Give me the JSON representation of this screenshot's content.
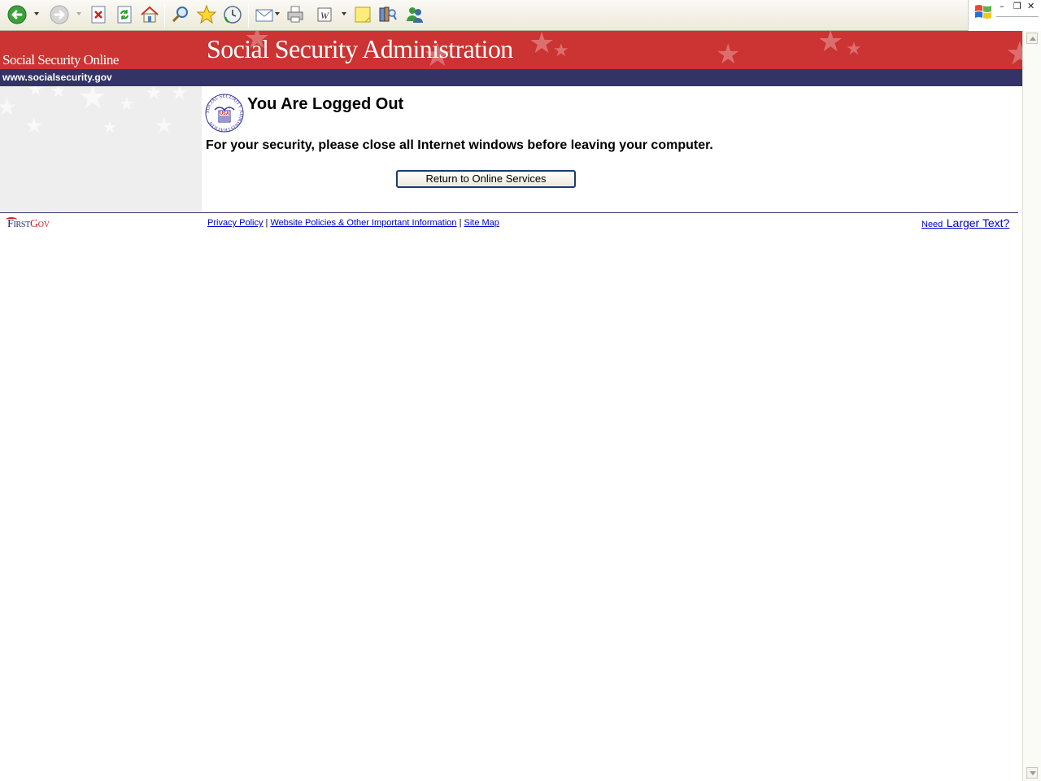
{
  "browser": {
    "toolbar_icons": [
      "back-icon",
      "forward-icon",
      "stop-icon",
      "refresh-icon",
      "home-icon",
      "search-icon",
      "favorites-icon",
      "history-icon",
      "mail-icon",
      "print-icon",
      "edit-icon",
      "discuss-icon",
      "research-icon",
      "messenger-icon"
    ],
    "window_controls": {
      "minimize": "–",
      "restore": "❐",
      "close": "✕"
    }
  },
  "banner": {
    "left_text": "Social Security Online",
    "title": "Social Security Administration",
    "url_text": "www.socialsecurity.gov"
  },
  "seal": {
    "text": "SOCIAL SECURITY ADMINISTRATION",
    "center": "USA"
  },
  "content": {
    "heading": "You Are Logged Out",
    "message": "For your security, please close all Internet windows before leaving your computer.",
    "return_button": "Return to Online Services"
  },
  "footer": {
    "firstgov_first": "First",
    "firstgov_gov": "Gov",
    "links": [
      "Privacy Policy",
      "Website Policies & Other Important Information",
      "Site Map"
    ],
    "separator": " | ",
    "need_text": "Need",
    "larger_text": "Larger Text?"
  },
  "colors": {
    "banner_red": "#cc3333",
    "banner_navy": "#333366",
    "link_blue": "#0000cc"
  }
}
